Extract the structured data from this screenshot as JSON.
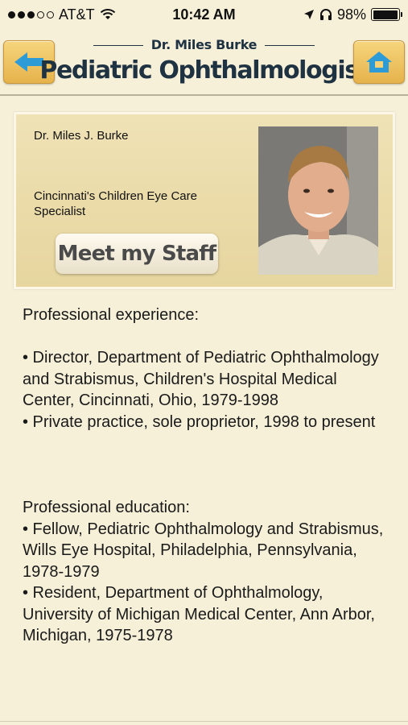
{
  "status_bar": {
    "carrier": "AT&T",
    "time": "10:42 AM",
    "battery_percent": "98%",
    "battery_level": 0.98,
    "icons": [
      "signal-dots-icon",
      "wifi-icon",
      "location-arrow-icon",
      "headphones-icon",
      "battery-icon"
    ]
  },
  "header": {
    "subtitle": "Dr. Miles Burke",
    "title": "Pediatric Ophthalmologist",
    "back_icon": "back-arrow-icon",
    "home_icon": "home-icon",
    "accent_color": "#1e3242",
    "button_color": "#eec463",
    "icon_color": "#2d9bd6"
  },
  "card": {
    "name": "Dr. Miles J. Burke",
    "tagline": "Cincinnati's Children Eye Care Specialist",
    "staff_button": "Meet my Staff"
  },
  "experience": {
    "heading": "Professional experience:",
    "items": [
      "• Director, Department of Pediatric Ophthalmology and Strabismus, Children's Hospital Medical Center, Cincinnati, Ohio, 1979-1998",
      "• Private practice, sole proprietor, 1998 to present"
    ]
  },
  "education": {
    "heading": "Professional education:",
    "items": [
      "• Fellow, Pediatric Ophthalmology and Strabismus, Wills Eye Hospital, Philadelphia, Pennsylvania, 1978-1979",
      "• Resident, Department of Ophthalmology, University of Michigan Medical Center, Ann Arbor, Michigan, 1975-1978"
    ]
  }
}
